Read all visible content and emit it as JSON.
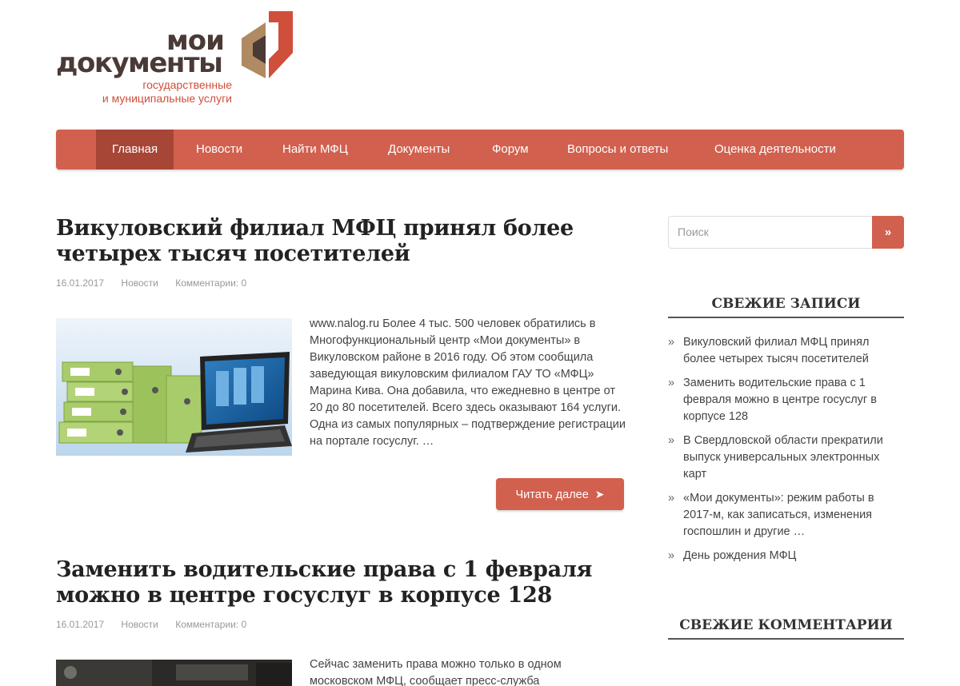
{
  "logo": {
    "line1": "мои",
    "line2": "документы",
    "sub1": "государственные",
    "sub2": "и муниципальные услуги"
  },
  "nav": {
    "items": [
      {
        "label": "Главная",
        "active": true
      },
      {
        "label": "Новости"
      },
      {
        "label": "Найти МФЦ"
      },
      {
        "label": "Документы"
      },
      {
        "label": "Форум"
      },
      {
        "label": "Вопросы и ответы"
      },
      {
        "label": "Оценка деятельности"
      }
    ]
  },
  "articles": [
    {
      "title_line1": "Викуловский филиал МФЦ принял более",
      "title_line2": "четырех тысяч посетителей",
      "date": "16.01.2017",
      "category": "Новости",
      "comments": "Комментарии: 0",
      "excerpt": "www.nalog.ru Более 4 тыс. 500 человек обратились в Многофункциональный центр «Мои документы» в Викуловском районе в 2016 году. Об этом сообщила заведующая викуловским филиалом ГАУ ТО «МФЦ» Марина Кива. Она добавила, что ежедневно в центре от 20 до 80 посетителей. Всего здесь оказывают 164 услуги. Одна из самых популярных – подтверждение регистрации на портале госуслуг. …",
      "read_more": "Читать далее"
    },
    {
      "title_line1": "Заменить водительские права с 1 февраля",
      "title_line2": "можно в центре госуслуг в корпусе 128",
      "date": "16.01.2017",
      "category": "Новости",
      "comments": "Комментарии: 0",
      "excerpt": "Сейчас заменить права можно только в одном московском МФЦ, сообщает пресс-служба"
    }
  ],
  "sidebar": {
    "search_placeholder": "Поиск",
    "search_button": "»",
    "recent_title": "СВЕЖИЕ ЗАПИСИ",
    "recent_bullet": "»",
    "recent": [
      "Викуловский филиал МФЦ принял более четырех тысяч посетителей",
      "Заменить водительские права с 1 февраля можно в центре госуслуг в корпусе 128",
      "В Свердловской области прекратили выпуск универсальных электронных карт",
      "«Мои документы»: режим работы в 2017-м, как записаться, изменения госпошлин и другие …",
      "День рождения МФЦ"
    ],
    "comments_title": "СВЕЖИЕ КОММЕНТАРИИ"
  },
  "colors": {
    "accent": "#d2604e",
    "accent_dark": "#a74637",
    "logo_brown": "#4a3a36",
    "logo_red": "#cf4f3a"
  }
}
